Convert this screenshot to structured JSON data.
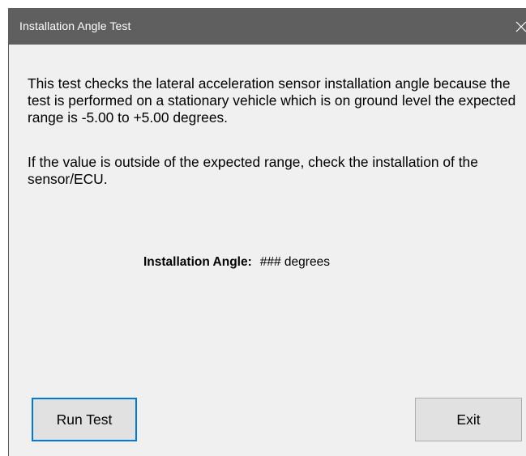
{
  "window": {
    "title": "Installation Angle Test",
    "close_icon": "close-icon"
  },
  "content": {
    "description": "This test checks the lateral acceleration sensor installation angle because the test is performed on a stationary vehicle which is on ground level the expected range is -5.00 to +5.00 degrees.",
    "instruction": "If the value is outside of the expected range, check the installation of the sensor/ECU.",
    "angle_label": "Installation Angle:",
    "angle_value": "### degrees"
  },
  "buttons": {
    "run_test_label": "Run Test",
    "exit_label": "Exit"
  },
  "colors": {
    "titlebar": "#5f5f5f",
    "window_bg": "#f0f0f0",
    "focus_border": "#0078d7",
    "button_bg": "#e1e1e1"
  }
}
